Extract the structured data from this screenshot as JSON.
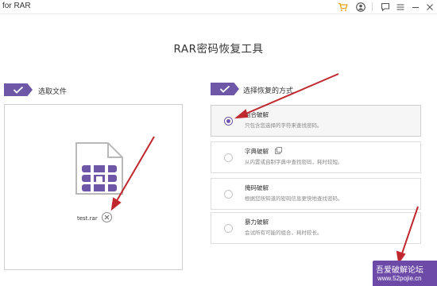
{
  "app": {
    "title": "for RAR"
  },
  "toolbar": {
    "icons": [
      "cart-icon",
      "account-icon",
      "feedback-icon",
      "menu-icon",
      "minimize-icon",
      "close-icon"
    ],
    "cart_color": "#e8a21a"
  },
  "main": {
    "title": "RAR密码恢复工具"
  },
  "left_section": {
    "label": "选取文件",
    "file": {
      "name": "test.rar",
      "icon": "rar-archive-icon"
    }
  },
  "right_section": {
    "label": "选择恢复的方式",
    "methods": [
      {
        "title": "组合破解",
        "desc": "只包含您选择的字符来查找密码。",
        "selected": true
      },
      {
        "title": "字典破解",
        "desc": "从内置或自制字典中查找密码，耗时较短。",
        "selected": false,
        "has_copy_icon": true
      },
      {
        "title": "掩码破解",
        "desc": "根据您所知道的密码信息更快地查找密码。",
        "selected": false
      },
      {
        "title": "暴力破解",
        "desc": "会试所有可能的组合，耗时较长。",
        "selected": false
      }
    ]
  },
  "watermark": {
    "line1": "吾爱破解论坛",
    "line2": "www.52pojie.cn"
  },
  "colors": {
    "accent": "#6d57a6",
    "annotation_arrow": "#c0282f"
  }
}
